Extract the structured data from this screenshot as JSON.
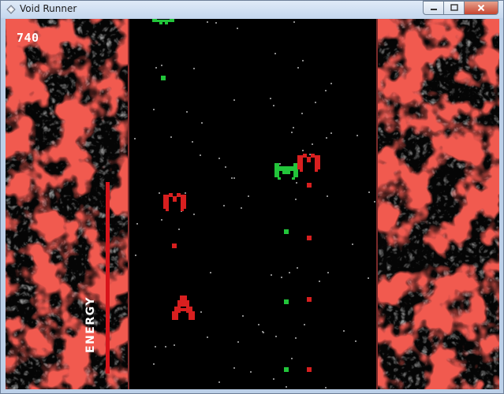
{
  "window": {
    "title": "Void Runner"
  },
  "hud": {
    "score": "740",
    "energy_label": "ENERGY",
    "energy_level": 1.0
  },
  "colors": {
    "ship_red": "#d81f1f",
    "enemy_green": "#22c53a",
    "wall_red": "#e02015",
    "wall_grey": "#4c4c4c",
    "star": "#8a8a8a",
    "energy_bar": "#d8141b"
  },
  "icons": [
    "app-icon",
    "minimize-icon",
    "maximize-icon",
    "close-icon"
  ]
}
